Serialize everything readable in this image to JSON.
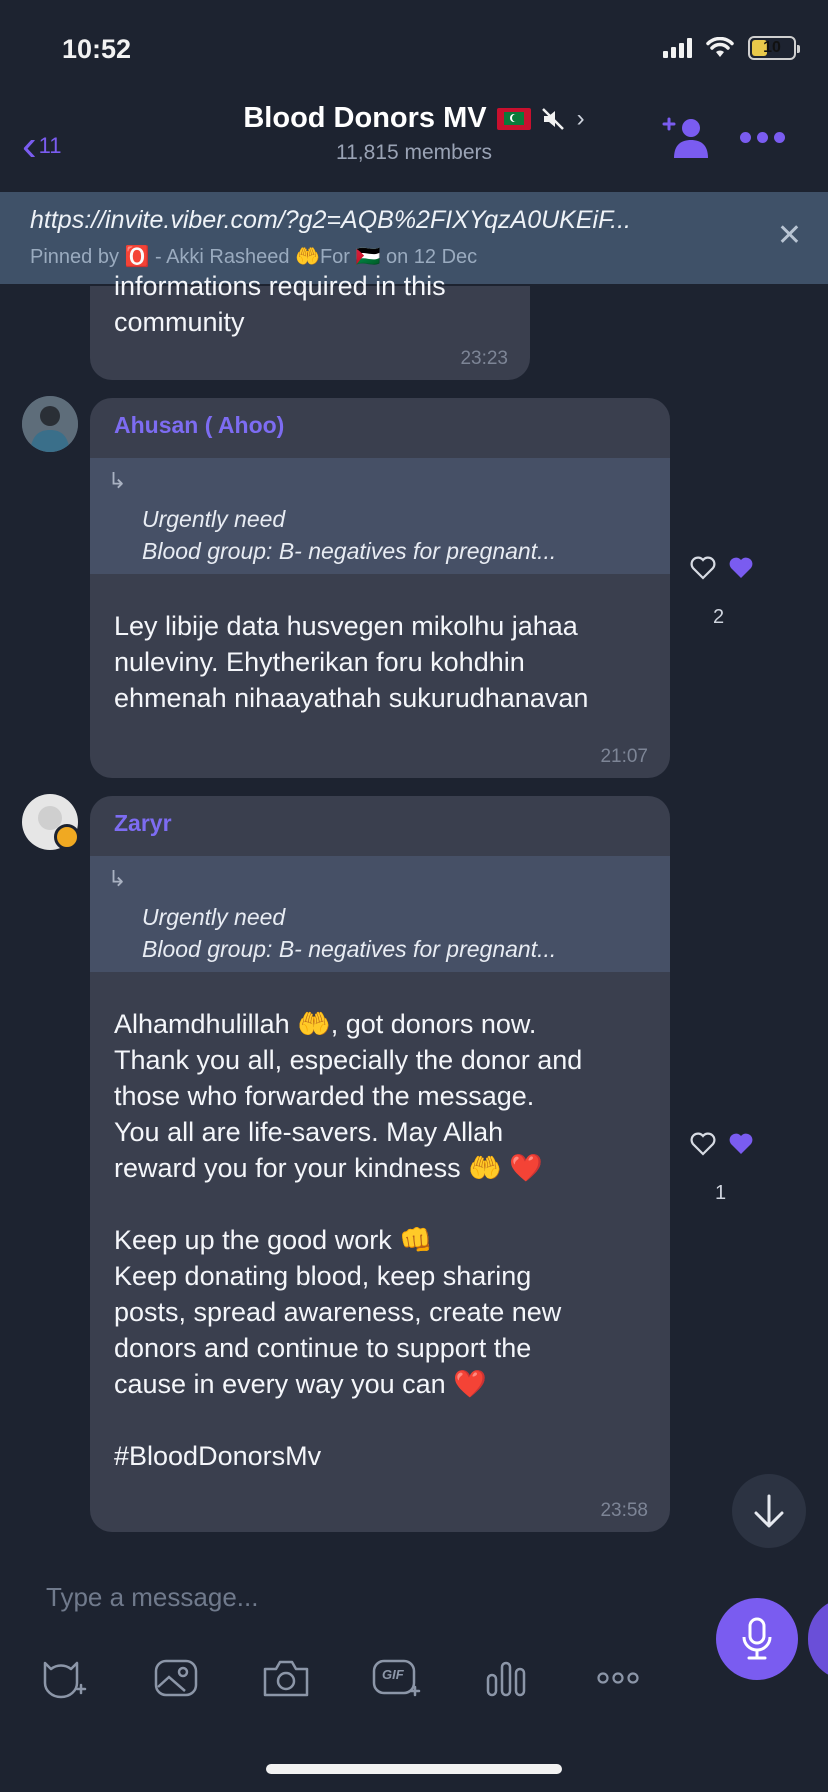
{
  "status_bar": {
    "time": "10:52",
    "battery": "10"
  },
  "header": {
    "back_count": "11",
    "title": "Blood Donors MV",
    "members": "11,815 members"
  },
  "pinned": {
    "link": "https://invite.viber.com/?g2=AQB%2FIXYqzA0UKEiF...",
    "by": "Pinned by 🅾️ - Akki Rasheed 🤲For 🇵🇸 on 12 Dec"
  },
  "messages": [
    {
      "partial_text": "informations required in this\ncommunity",
      "time": "23:23"
    },
    {
      "sender": "Ahusan ( Ahoo)",
      "reply_line1": "Urgently need",
      "reply_line2": "Blood group: B- negatives for pregnant...",
      "text": "Ley libije data husvegen mikolhu jahaa\nnuleviny. Ehytherikan foru kohdhin\nehmenah nihaayathah sukurudhanavan",
      "time": "21:07",
      "reaction_count": "2"
    },
    {
      "sender": "Zaryr",
      "reply_line1": "Urgently need",
      "reply_line2": "Blood group: B- negatives for pregnant...",
      "text": "Alhamdhulillah 🤲, got donors now.\nThank you all, especially the donor and\nthose who forwarded the message.\nYou all are life-savers. May Allah\nreward you for your kindness 🤲 ❤️\n\nKeep up the good work 👊\nKeep donating blood, keep sharing\nposts, spread awareness, create new\ndonors and continue to support the\ncause in every way you can ❤️\n\n#BloodDonorsMv",
      "time": "23:58",
      "reaction_count": "1"
    }
  ],
  "composer": {
    "placeholder": "Type a message..."
  },
  "toolbar": {
    "gif_label": "GIF"
  },
  "colors": {
    "accent": "#7a5cf0",
    "bubble": "#3a3f4e",
    "background": "#1d2330",
    "pinned": "#3f5168"
  }
}
